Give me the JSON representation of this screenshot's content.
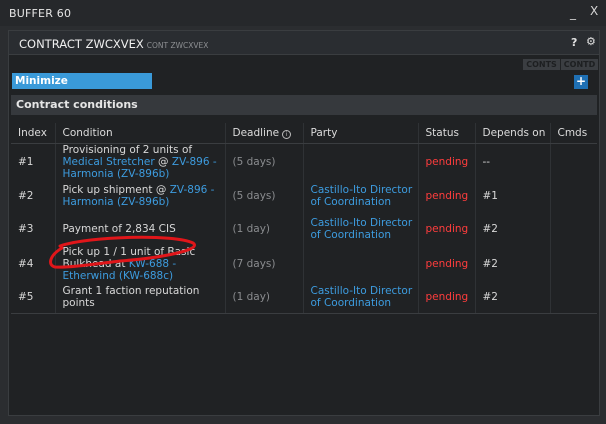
{
  "window": {
    "title": "BUFFER 60",
    "minimize_glyph": "_",
    "close_glyph": "X"
  },
  "panel": {
    "title": "CONTRACT ZWCXVEX",
    "subtitle": "CONT ZWCXVEX",
    "help_glyph": "?",
    "settings_icon": "gear-icon"
  },
  "toolbar": {
    "conts_label": "CONTS",
    "contd_label": "CONTD",
    "minimize_label": "Minimize",
    "add_label": "+"
  },
  "section": {
    "title": "Contract conditions"
  },
  "table": {
    "headers": {
      "index": "Index",
      "condition": "Condition",
      "deadline": "Deadline",
      "party": "Party",
      "status": "Status",
      "depends": "Depends on",
      "cmds": "Cmds"
    },
    "rows": [
      {
        "index": "#1",
        "condition_pre": "Provisioning of 2 units of ",
        "condition_link1": "Medical Stretcher",
        "condition_mid": " @ ",
        "condition_link2": "ZV-896 - Harmonia (ZV-896b)",
        "deadline": "(5 days)",
        "party": "",
        "status": "pending",
        "depends": "--"
      },
      {
        "index": "#2",
        "condition_pre": "Pick up shipment @ ",
        "condition_link2": "ZV-896 - Harmonia (ZV-896b)",
        "deadline": "(5 days)",
        "party": "Castillo-Ito Director of Coordination",
        "status": "pending",
        "depends": "#1"
      },
      {
        "index": "#3",
        "condition_pre": "Payment of 2,834 CIS",
        "deadline": "(1 day)",
        "party": "Castillo-Ito Director of Coordination",
        "status": "pending",
        "depends": "#2"
      },
      {
        "index": "#4",
        "condition_pre": "Pick up 1 / 1 unit of Basic Bulkhead at ",
        "condition_link2": "KW-688 - Etherwind (KW-688c)",
        "deadline": "(7 days)",
        "party": "",
        "status": "pending",
        "depends": "#2"
      },
      {
        "index": "#5",
        "condition_pre": "Grant 1 faction reputation points",
        "deadline": "(1 day)",
        "party": "Castillo-Ito Director of Coordination",
        "status": "pending",
        "depends": "#2"
      }
    ]
  },
  "colors": {
    "link": "#3d9cdf",
    "pending": "#ff3d3d",
    "accent": "#3a9ad9",
    "annotation": "#e0161a"
  }
}
